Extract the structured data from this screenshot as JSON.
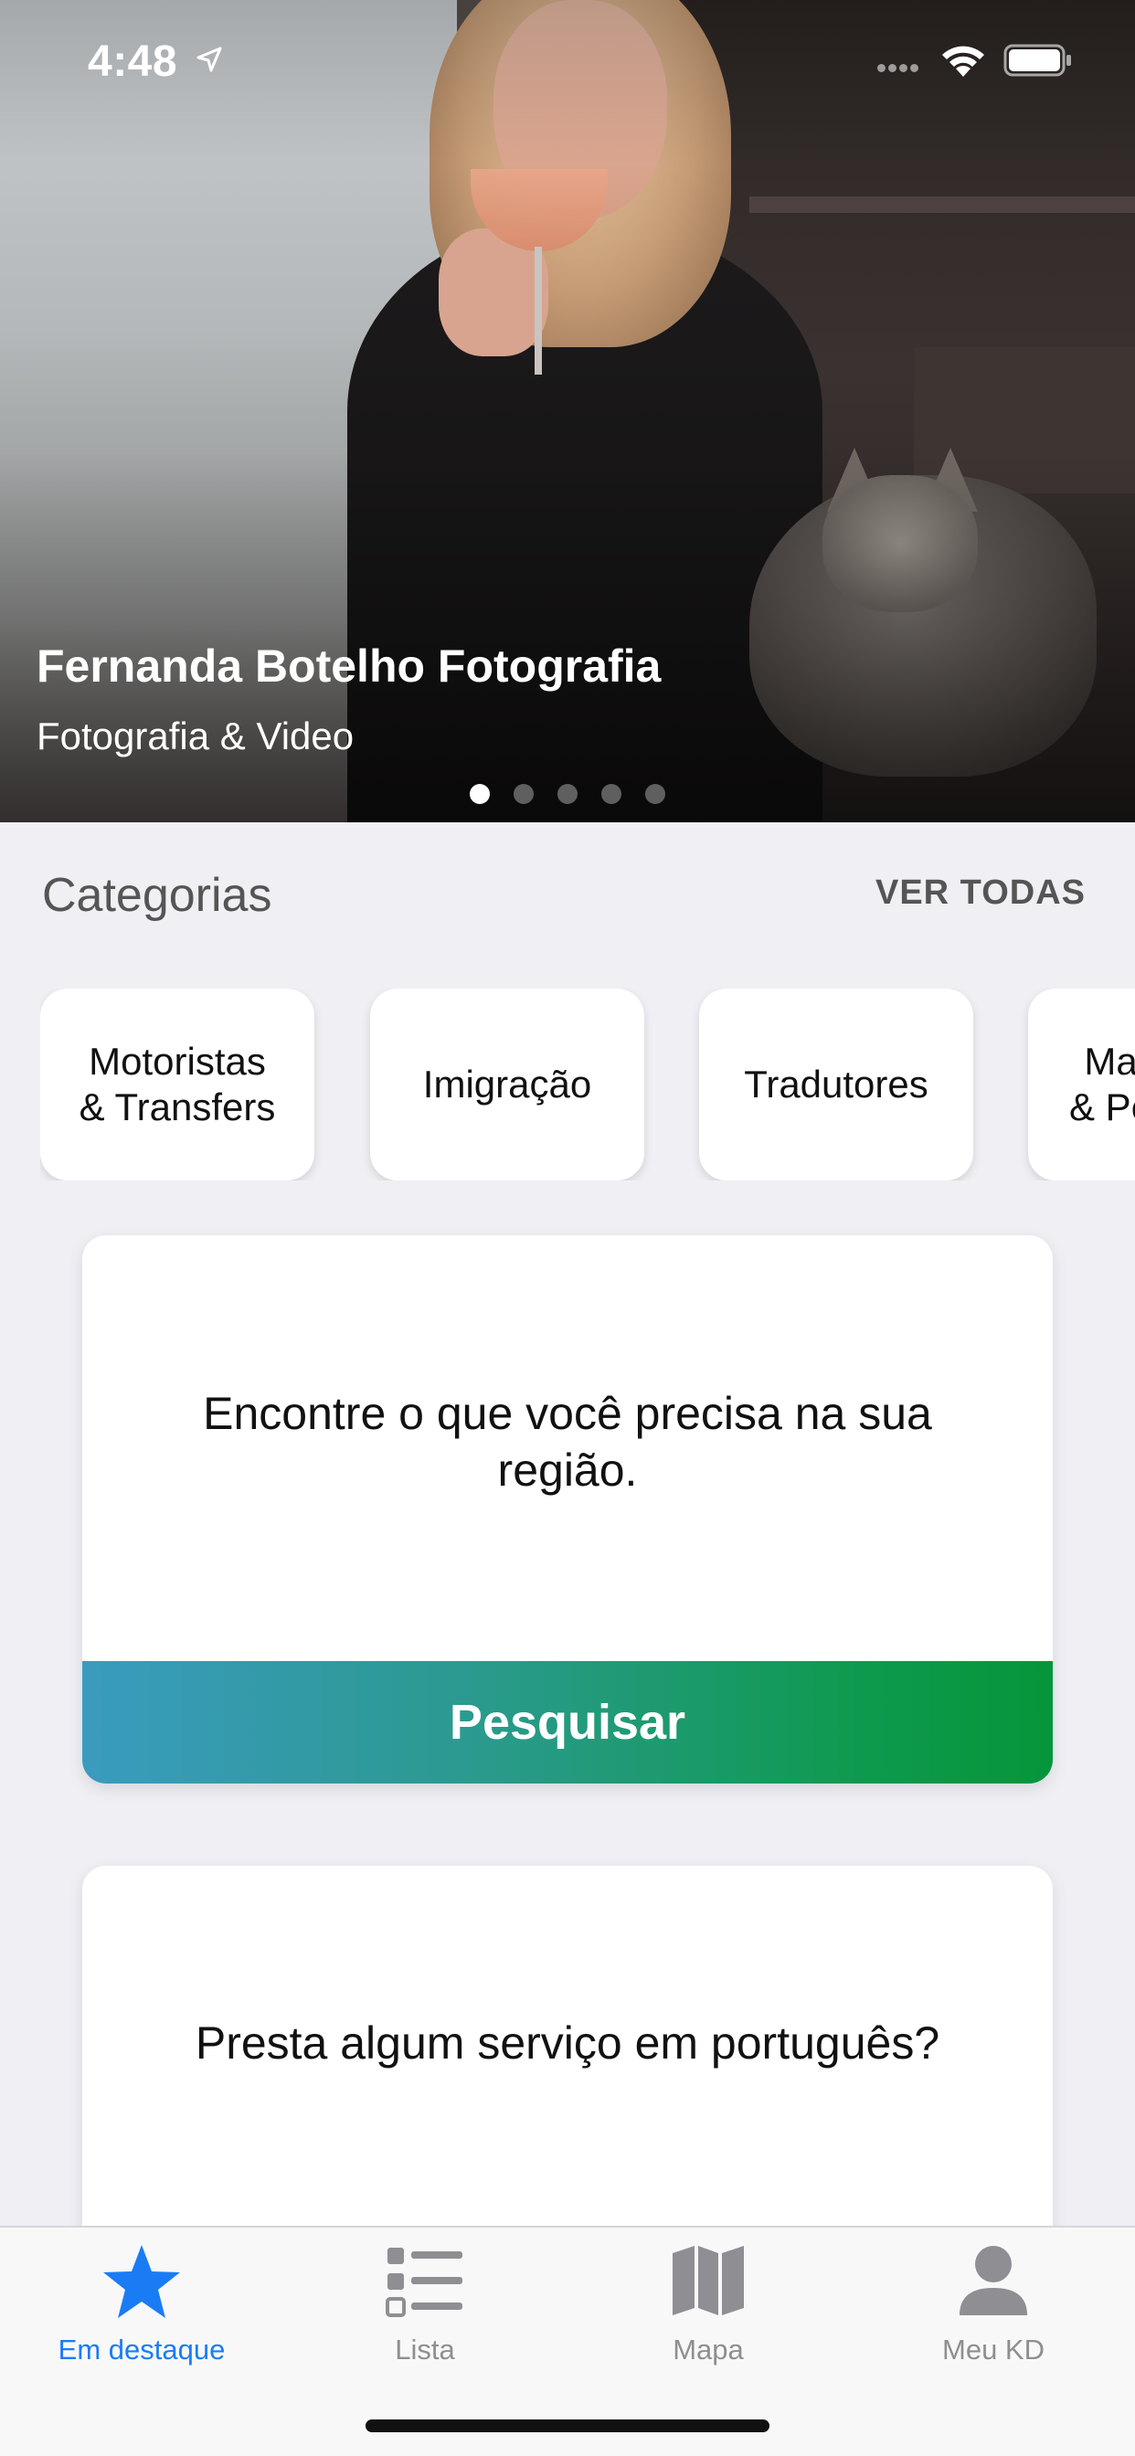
{
  "status_bar": {
    "time": "4:48"
  },
  "hero": {
    "title": "Fernanda Botelho Fotografia",
    "subtitle": "Fotografia & Video",
    "dots_total": 5,
    "active_dot": 0
  },
  "categories": {
    "heading": "Categorias",
    "see_all_label": "VER TODAS",
    "items": [
      {
        "label": "Motoristas\n& Transfers"
      },
      {
        "label": "Imigração"
      },
      {
        "label": "Tradutores"
      },
      {
        "label": "Ma\n& Pe"
      }
    ]
  },
  "search_card": {
    "text": "Encontre o que você precisa na sua região.",
    "button_label": "Pesquisar"
  },
  "promo_card": {
    "text": "Presta algum serviço em português?"
  },
  "tab_bar": {
    "tabs": [
      {
        "label": "Em destaque",
        "icon": "star-icon",
        "active": true
      },
      {
        "label": "Lista",
        "icon": "list-icon",
        "active": false
      },
      {
        "label": "Mapa",
        "icon": "map-icon",
        "active": false
      },
      {
        "label": "Meu KD",
        "icon": "person-icon",
        "active": false
      }
    ]
  },
  "colors": {
    "accent_blue": "#1a7cf5",
    "button_gradient_start": "#3a9bbf",
    "button_gradient_end": "#06953a",
    "background": "#efeff4"
  }
}
